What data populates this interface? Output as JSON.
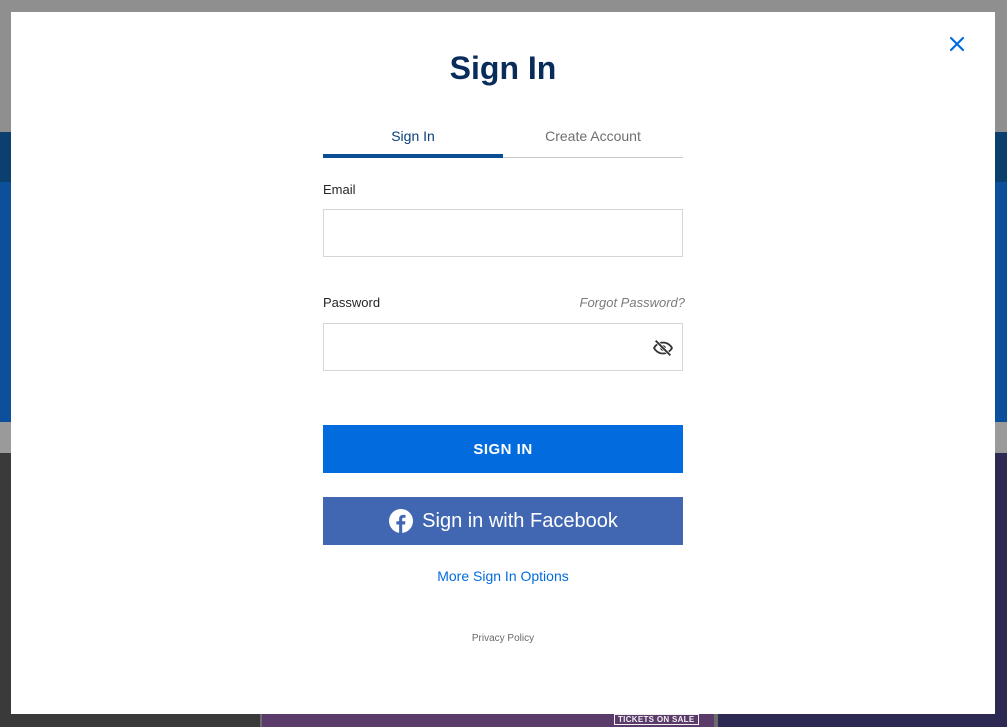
{
  "backdrop": {
    "tickets_on_sale": "TICKETS ON SALE"
  },
  "modal": {
    "title": "Sign In",
    "tabs": [
      {
        "label": "Sign In",
        "active": true
      },
      {
        "label": "Create Account",
        "active": false
      }
    ],
    "email": {
      "label": "Email",
      "value": "",
      "placeholder": ""
    },
    "password": {
      "label": "Password",
      "value": "",
      "placeholder": "",
      "forgot_label": "Forgot Password?",
      "visibility_icon": "eye-slash-icon"
    },
    "sign_in_button": "SIGN IN",
    "facebook_button": "Sign in with Facebook",
    "more_options": "More Sign In Options",
    "privacy_policy": "Privacy Policy",
    "close_icon": "close-icon"
  },
  "colors": {
    "primary": "#026cdf",
    "title": "#0a2c5a",
    "facebook": "#4267b2",
    "tab_active": "#0a4f96"
  }
}
